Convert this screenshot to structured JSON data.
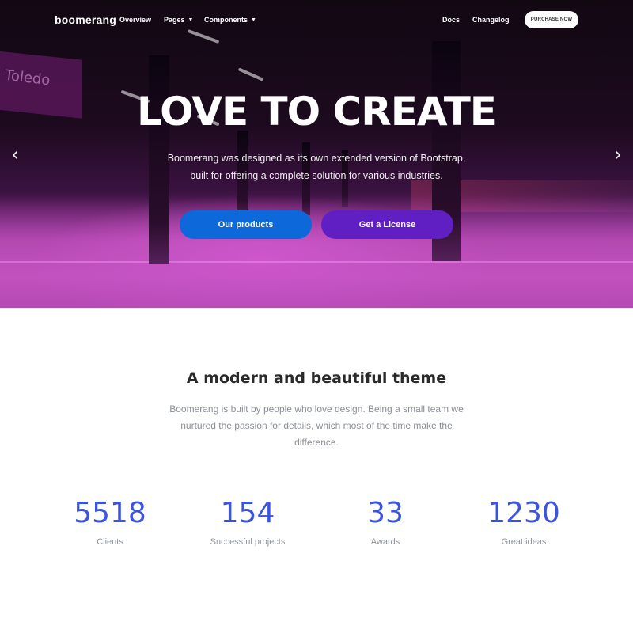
{
  "navbar": {
    "brand": "boomerang",
    "left_items": [
      {
        "label": "Overview",
        "dropdown": false
      },
      {
        "label": "Pages",
        "dropdown": true
      },
      {
        "label": "Components",
        "dropdown": true
      }
    ],
    "right_items": [
      {
        "label": "Docs"
      },
      {
        "label": "Changelog"
      }
    ],
    "cta": "PURCHASE NOW"
  },
  "hero": {
    "title": "LOVE TO CREATE",
    "subtitle": "Boomerang was designed as its own extended version of Bootstrap, built for offering a complete solution for various industries.",
    "primary_button": "Our products",
    "secondary_button": "Get a License",
    "prev_arrow": "‹",
    "next_arrow": "›",
    "sign_text": "Toledo"
  },
  "intro": {
    "title": "A modern and beautiful theme",
    "text": "Boomerang is built by people who love design. Being a small team we nurtured the passion for details, which most of the time make the difference."
  },
  "stats": [
    {
      "value": "5518",
      "label": "Clients"
    },
    {
      "value": "154",
      "label": "Successful projects"
    },
    {
      "value": "33",
      "label": "Awards"
    },
    {
      "value": "1230",
      "label": "Great ideas"
    }
  ],
  "colors": {
    "accent_blue": "#0d68da",
    "accent_purple": "#5f1fc2",
    "stat_blue": "#3b54e0"
  },
  "icons": {
    "prev": "chevron-left-icon",
    "next": "chevron-right-icon",
    "dropdown": "caret-down-icon"
  }
}
